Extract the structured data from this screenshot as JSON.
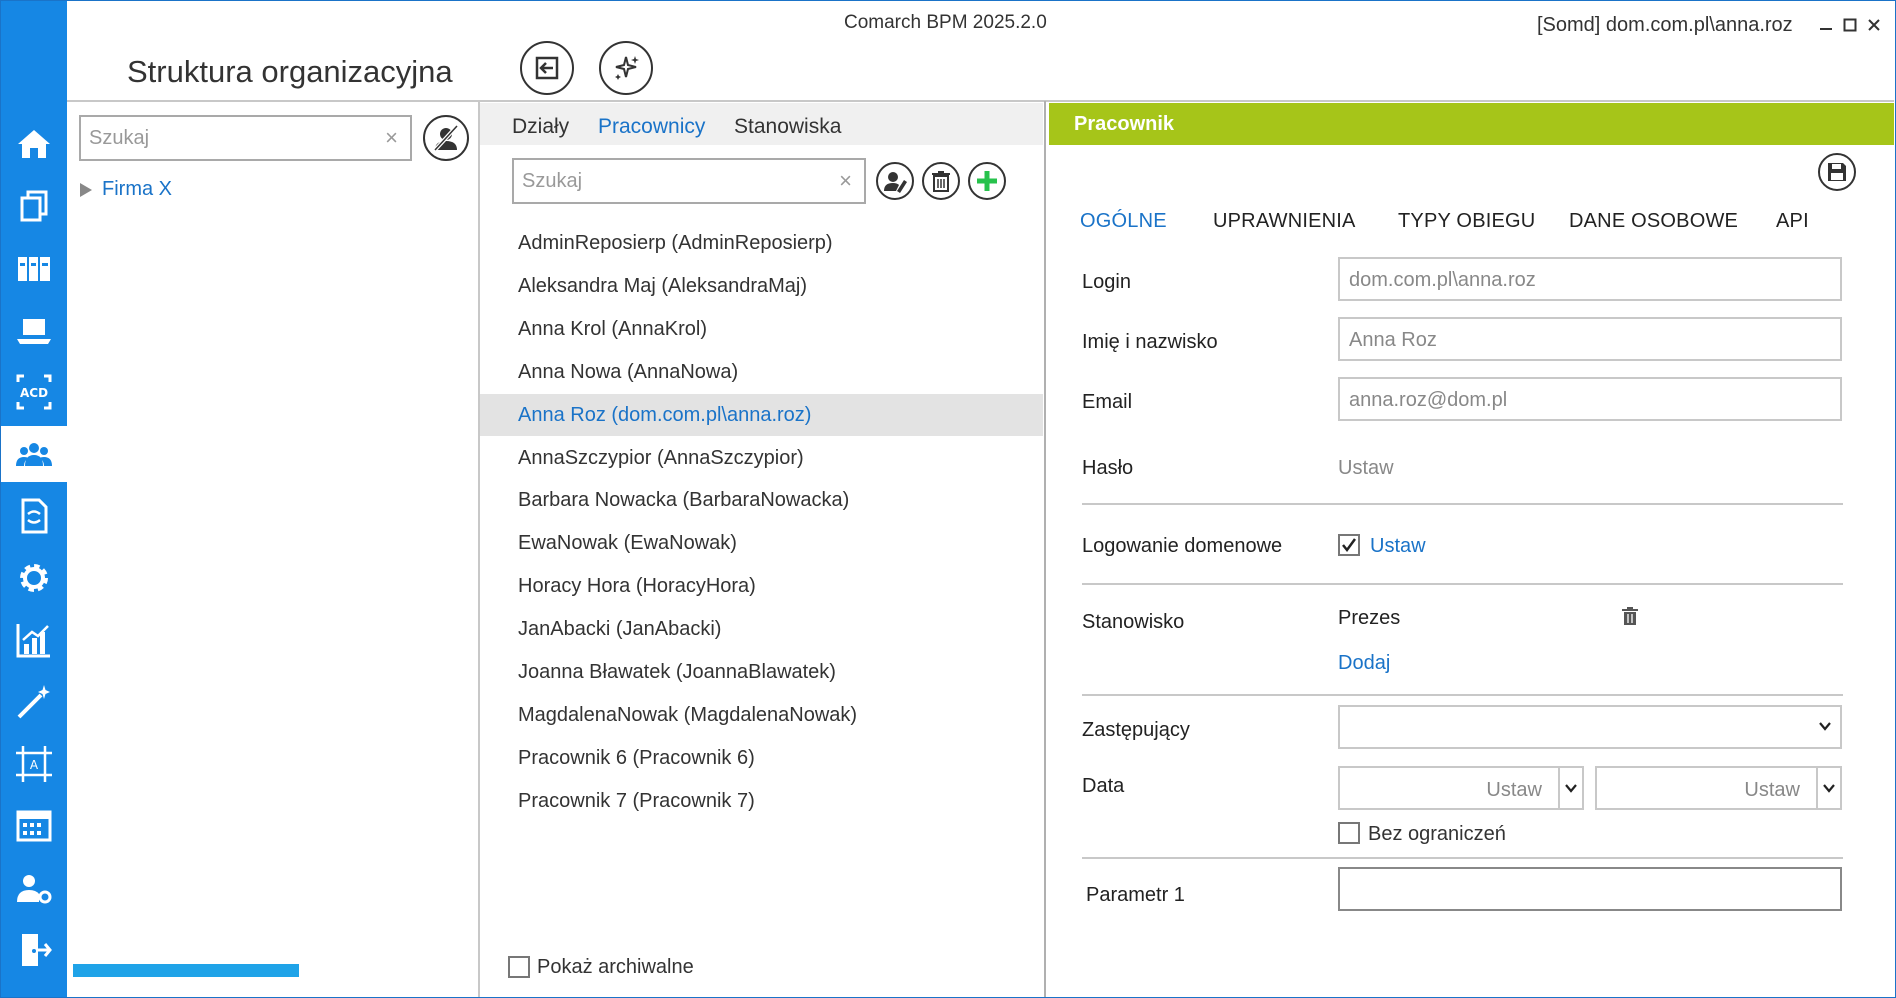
{
  "window": {
    "app_title": "Comarch BPM  2025.2.0",
    "user_info": "[Somd]  dom.com.pl\\anna.roz"
  },
  "nav": {
    "items": [
      {
        "icon": "home-icon"
      },
      {
        "icon": "documents-icon"
      },
      {
        "icon": "binders-icon"
      },
      {
        "icon": "laptop-icon"
      },
      {
        "icon": "acd-icon"
      },
      {
        "icon": "users-icon",
        "active": true
      },
      {
        "icon": "document-sync-icon"
      },
      {
        "icon": "gear-icon"
      },
      {
        "icon": "chart-icon"
      },
      {
        "icon": "magic-wand-icon"
      },
      {
        "icon": "designer-icon"
      },
      {
        "icon": "calendar-icon"
      },
      {
        "icon": "user-settings-icon"
      },
      {
        "icon": "exit-icon"
      }
    ]
  },
  "page": {
    "title": "Struktura organizacyjna"
  },
  "tree": {
    "search_placeholder": "Szukaj",
    "root_label": "Firma X"
  },
  "middle": {
    "tabs": [
      "Działy",
      "Pracownicy",
      "Stanowiska"
    ],
    "active_tab": "Pracownicy",
    "search_placeholder": "Szukaj",
    "employees": [
      "AdminReposierp (AdminReposierp)",
      "Aleksandra Maj (AleksandraMaj)",
      "Anna Krol (AnnaKrol)",
      "Anna Nowa (AnnaNowa)",
      "Anna Roz (dom.com.pl\\anna.roz)",
      "AnnaSzczypior (AnnaSzczypior)",
      "Barbara Nowacka (BarbaraNowacka)",
      "EwaNowak (EwaNowak)",
      "Horacy Hora (HoracyHora)",
      "JanAbacki (JanAbacki)",
      "Joanna Bławatek (JoannaBlawatek)",
      "MagdalenaNowak (MagdalenaNowak)",
      "Pracownik 6 (Pracownik 6)",
      "Pracownik 7 (Pracownik 7)"
    ],
    "selected_employee": "Anna Roz (dom.com.pl\\anna.roz)",
    "show_archived_label": "Pokaż archiwalne",
    "show_archived_checked": false
  },
  "right": {
    "header": "Pracownik",
    "tabs": [
      "OGÓLNE",
      "UPRAWNIENIA",
      "TYPY OBIEGU",
      "DANE OSOBOWE",
      "API"
    ],
    "active_tab": "OGÓLNE",
    "login_label": "Login",
    "login_value": "dom.com.pl\\anna.roz",
    "name_label": "Imię i nazwisko",
    "name_value": "Anna Roz",
    "email_label": "Email",
    "email_value": "anna.roz@dom.pl",
    "password_label": "Hasło",
    "password_value": "Ustaw",
    "domain_login_label": "Logowanie domenowe",
    "domain_login_checked": true,
    "domain_login_value": "Ustaw",
    "position_label": "Stanowisko",
    "position_value": "Prezes",
    "add_label": "Dodaj",
    "substitute_label": "Zastępujący",
    "substitute_value": "",
    "date_label": "Data",
    "date_from": "Ustaw",
    "date_to": "Ustaw",
    "no_limit_label": "Bez ograniczeń",
    "no_limit_checked": false,
    "param1_label": "Parametr 1",
    "param1_value": ""
  },
  "colors": {
    "nav_blue": "#1687e4",
    "accent_blue": "#1a73c8",
    "header_green": "#a6c519",
    "add_green": "#27c24c",
    "progress_blue": "#1fa3e8"
  }
}
